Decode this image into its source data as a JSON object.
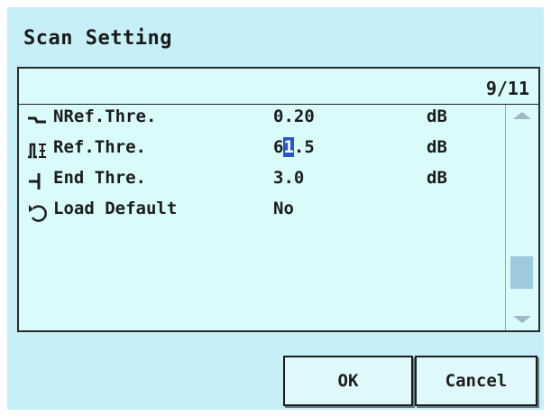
{
  "dialog": {
    "title": "Scan Setting",
    "page_indicator": "9/11"
  },
  "rows": [
    {
      "icon": "nref-threshold-icon",
      "label": "NRef.Thre.",
      "value": "0.20",
      "unit": "dB"
    },
    {
      "icon": "ref-threshold-icon",
      "label": "Ref.Thre.",
      "value_before": "6",
      "value_cursor": "1",
      "value_after": ".5",
      "unit": "dB"
    },
    {
      "icon": "end-threshold-icon",
      "label": "End Thre.",
      "value": "3.0",
      "unit": "dB"
    },
    {
      "icon": "load-default-icon",
      "label": "Load Default",
      "value": "No",
      "unit": ""
    }
  ],
  "buttons": {
    "ok": "OK",
    "cancel": "Cancel"
  },
  "colors": {
    "dialog_background": "#c7eff8",
    "panel_background": "#d9fbfb",
    "cursor_highlight": "#2a55c8",
    "scroll_thumb": "#9fc9de"
  }
}
